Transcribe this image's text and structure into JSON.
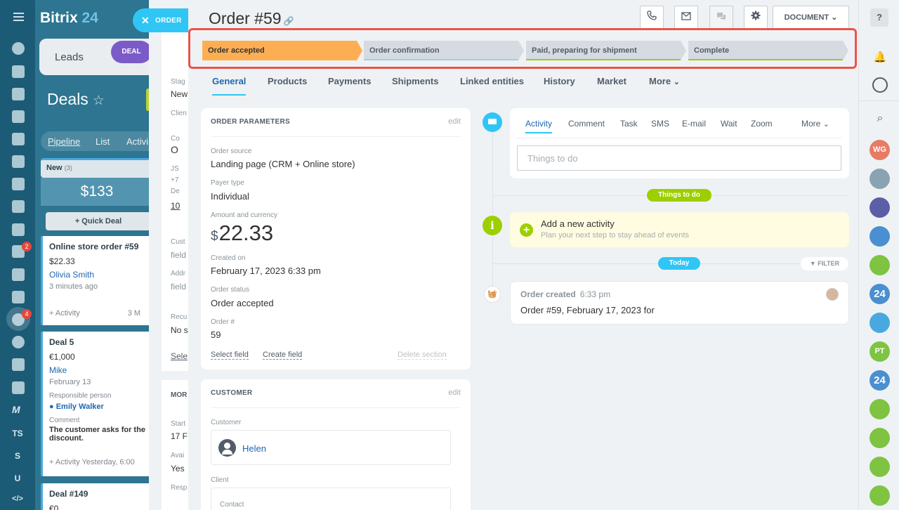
{
  "leftnav": {
    "badges": {
      "mail": "2",
      "crm": "4"
    },
    "letters": [
      "TS",
      "S",
      "U"
    ]
  },
  "bg": {
    "logo": "Bitrix",
    "logo_num": "24",
    "leads_label": "Leads",
    "deal_pill": "DEAL",
    "deals_title": "Deals",
    "views": [
      "Pipeline",
      "List",
      "Activi"
    ],
    "column": {
      "name": "New",
      "count": "(3)",
      "sum": "$133"
    },
    "quick_deal": "+ Quick Deal",
    "cards": [
      {
        "title": "Online store order #59",
        "price": "$22.33",
        "user": "Olivia Smith",
        "date": "3 minutes ago",
        "activity": "+ Activity",
        "extra": "3 M"
      },
      {
        "title": "Deal 5",
        "price": "€1,000",
        "user": "Mike",
        "date": "February 13",
        "resp_label": "Responsible person",
        "resp": "Emily Walker",
        "comment_label": "Comment",
        "comment": "The customer asks for the",
        "comment2": "discount.",
        "activity": "+ Activity Yesterday, 6:00"
      },
      {
        "title": "Deal #149",
        "price": "€0"
      }
    ],
    "under": {
      "stage_lbl": "Stag",
      "stage": "New",
      "client": "Clien",
      "co": "Co",
      "o": "O",
      "js": "JS",
      "plus": "+7",
      "de": "De",
      "ten": "10",
      "cust": "Cust",
      "field": "field",
      "addr": "Addr",
      "field2": "field",
      "recu": "Recu",
      "no": "No s",
      "sele": "Sele",
      "more": "MOR",
      "start": "Start",
      "f17": "17 F",
      "avai": "Avai",
      "yes": "Yes",
      "resp": "Resp"
    }
  },
  "order_pill": {
    "label": "ORDER",
    "close": "✕"
  },
  "slider": {
    "title": "Order #59",
    "document_label": "DOCUMENT",
    "stages": [
      {
        "label": "Order accepted",
        "color": "#fdae52",
        "state": "active"
      },
      {
        "label": "Order confirmation",
        "color": "#d5dbe0",
        "underline": "#9dcfea"
      },
      {
        "label": "Paid, preparing for shipment",
        "color": "#d5dbe0",
        "underline": "#9ccc1b"
      },
      {
        "label": "Complete",
        "color": "#d5dbe0",
        "underline": "#9ccc1b"
      }
    ],
    "tabs": [
      "General",
      "Products",
      "Payments",
      "Shipments",
      "Linked entities",
      "History",
      "Market",
      "More"
    ],
    "params": {
      "header": "ORDER PARAMETERS",
      "edit": "edit",
      "source_label": "Order source",
      "source": "Landing page (CRM + Online store)",
      "payer_label": "Payer type",
      "payer": "Individual",
      "amount_label": "Amount and currency",
      "currency": "$",
      "amount": "22.33",
      "created_label": "Created on",
      "created": "February 17, 2023 6:33 pm",
      "status_label": "Order status",
      "status": "Order accepted",
      "number_label": "Order #",
      "number": "59",
      "select_field": "Select field",
      "create_field": "Create field",
      "delete_section": "Delete section"
    },
    "customer": {
      "header": "CUSTOMER",
      "edit": "edit",
      "customer_label": "Customer",
      "name": "Helen",
      "client_label": "Client",
      "contact_label": "Contact"
    },
    "activity": {
      "tabs": [
        "Activity",
        "Comment",
        "Task",
        "SMS",
        "E-mail",
        "Wait",
        "Zoom"
      ],
      "more": "More",
      "placeholder": "Things to do",
      "things_pill": "Things to do",
      "add_title": "Add a new activity",
      "add_sub": "Plan your next step to stay ahead of events",
      "today": "Today",
      "filter": "FILTER",
      "event_title": "Order created",
      "event_time": "6:33 pm",
      "event_text": "Order #59, February 17, 2023 for"
    }
  },
  "rightnav": {
    "avatars": [
      "WG",
      "PT",
      "24",
      "24"
    ]
  }
}
